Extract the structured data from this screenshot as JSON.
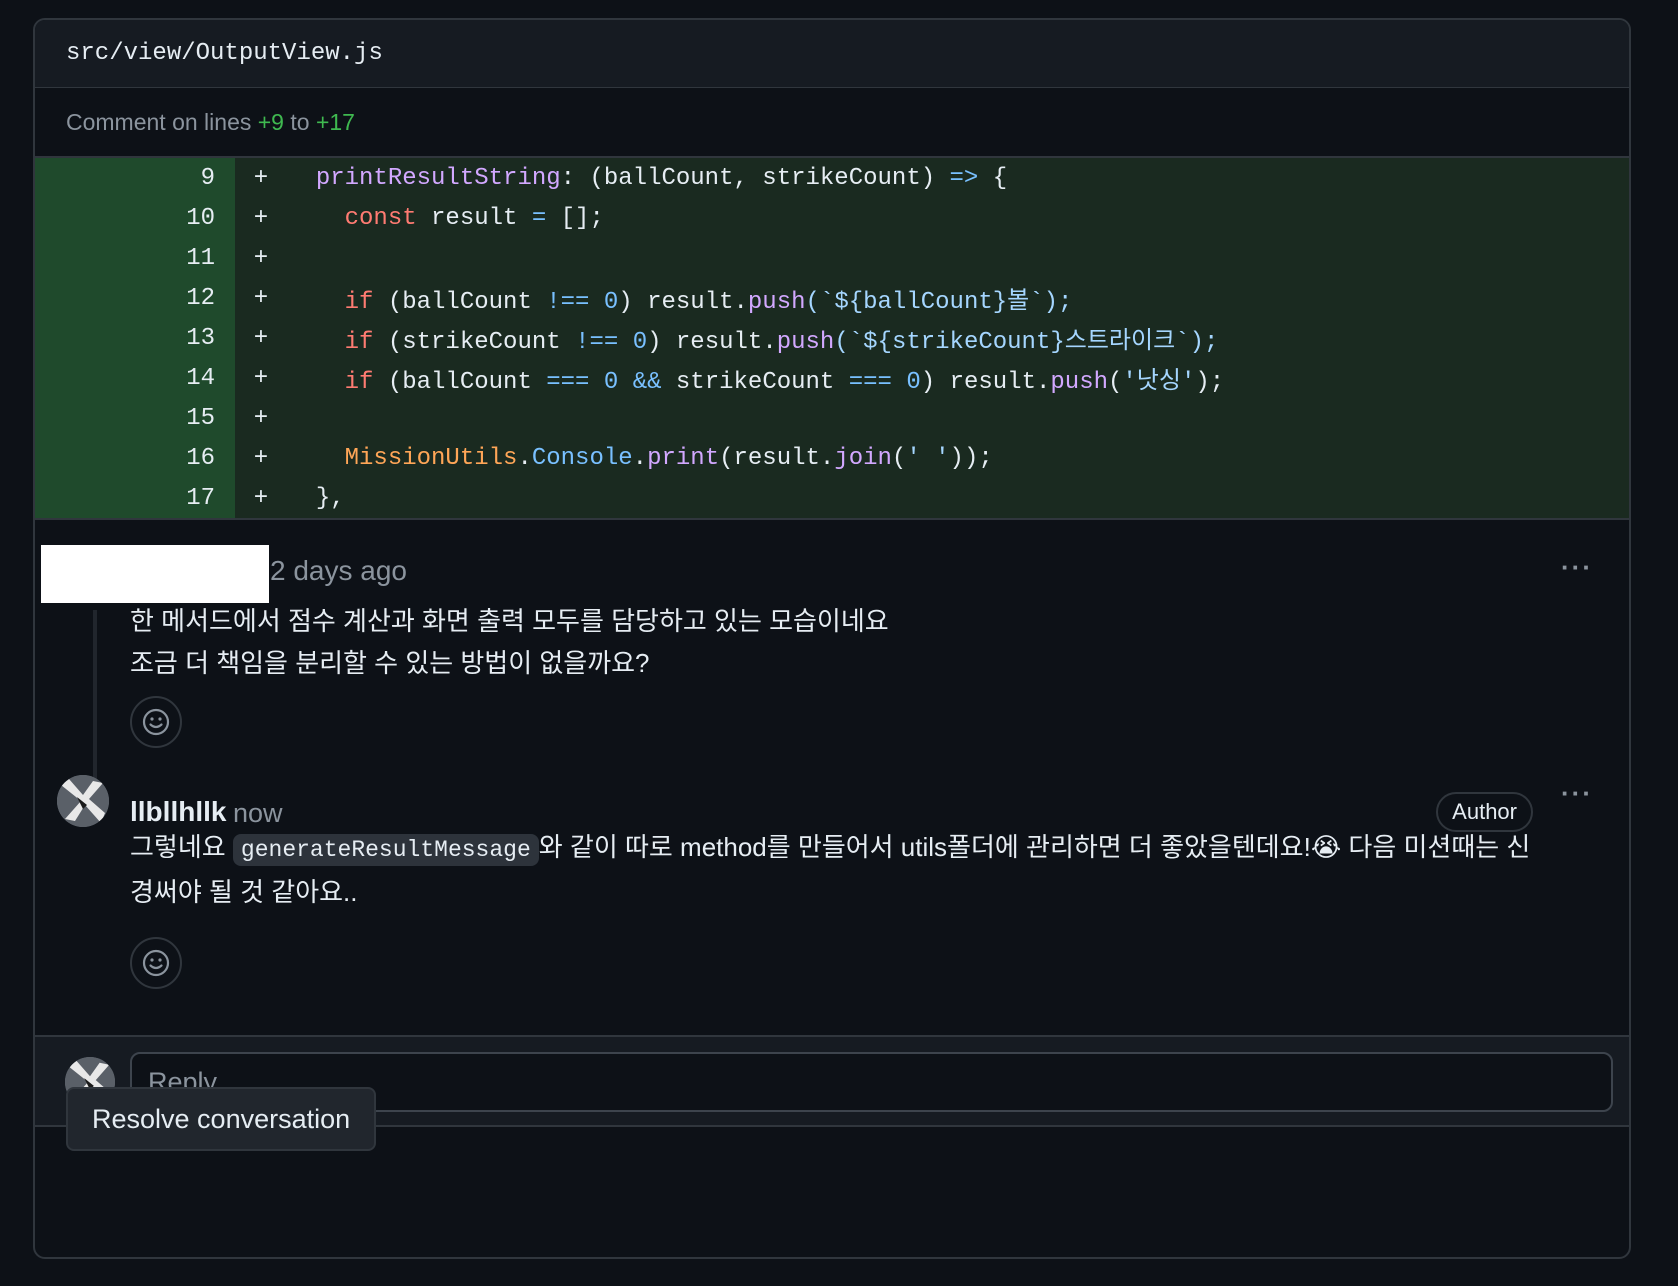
{
  "file": {
    "path": "src/view/OutputView.js"
  },
  "comment_on": {
    "prefix": "Comment on lines",
    "start": "+9",
    "joiner": "to",
    "end": "+17"
  },
  "diff": {
    "lines": [
      {
        "num": "9",
        "sign": "+"
      },
      {
        "num": "10",
        "sign": "+"
      },
      {
        "num": "11",
        "sign": "+"
      },
      {
        "num": "12",
        "sign": "+"
      },
      {
        "num": "13",
        "sign": "+"
      },
      {
        "num": "14",
        "sign": "+"
      },
      {
        "num": "15",
        "sign": "+"
      },
      {
        "num": "16",
        "sign": "+"
      },
      {
        "num": "17",
        "sign": "+"
      }
    ],
    "code": {
      "l9": [
        "printResultString",
        ": (ballCount, strikeCount) ",
        "=>",
        " {"
      ],
      "l10": [
        "const",
        " result ",
        "=",
        " [];"
      ],
      "l12": [
        "if",
        " (ballCount ",
        "!==",
        " ",
        "0",
        ") result.",
        "push",
        "(`${ballCount}볼`);"
      ],
      "l13": [
        "if",
        " (strikeCount ",
        "!==",
        " ",
        "0",
        ") result.",
        "push",
        "(`${strikeCount}스트라이크`);"
      ],
      "l14": [
        "if",
        " (ballCount ",
        "===",
        " ",
        "0",
        " ",
        "&&",
        " strikeCount ",
        "===",
        " ",
        "0",
        ") result.",
        "push",
        "(",
        "'낫싱'",
        ");"
      ],
      "l16": [
        "MissionUtils",
        ".",
        "Console",
        ".",
        "print",
        "(result.",
        "join",
        "(",
        "' '",
        "));"
      ],
      "l17": [
        "},"
      ]
    }
  },
  "comment1": {
    "time": "2 days ago",
    "body_line1": "한 메서드에서 점수 계산과 화면 출력 모두를 담당하고 있는 모습이네요",
    "body_line2": "조금 더 책임을 분리할 수 있는 방법이 없을까요?",
    "menu": "···"
  },
  "comment2": {
    "author": "llbllhllk",
    "time": "now",
    "badge": "Author",
    "menu": "···",
    "body_pre": "그렇네요 ",
    "body_code": "generateResultMessage",
    "body_post": "와 같이 따로 method를 만들어서 utils폴더에 관리하면 더 좋았을텐데요!😭 다음 미션때는 신",
    "body_line2": "경써야 될 것 같아요.."
  },
  "reply": {
    "placeholder": "Reply..."
  },
  "resolve_label": "Resolve conversation"
}
